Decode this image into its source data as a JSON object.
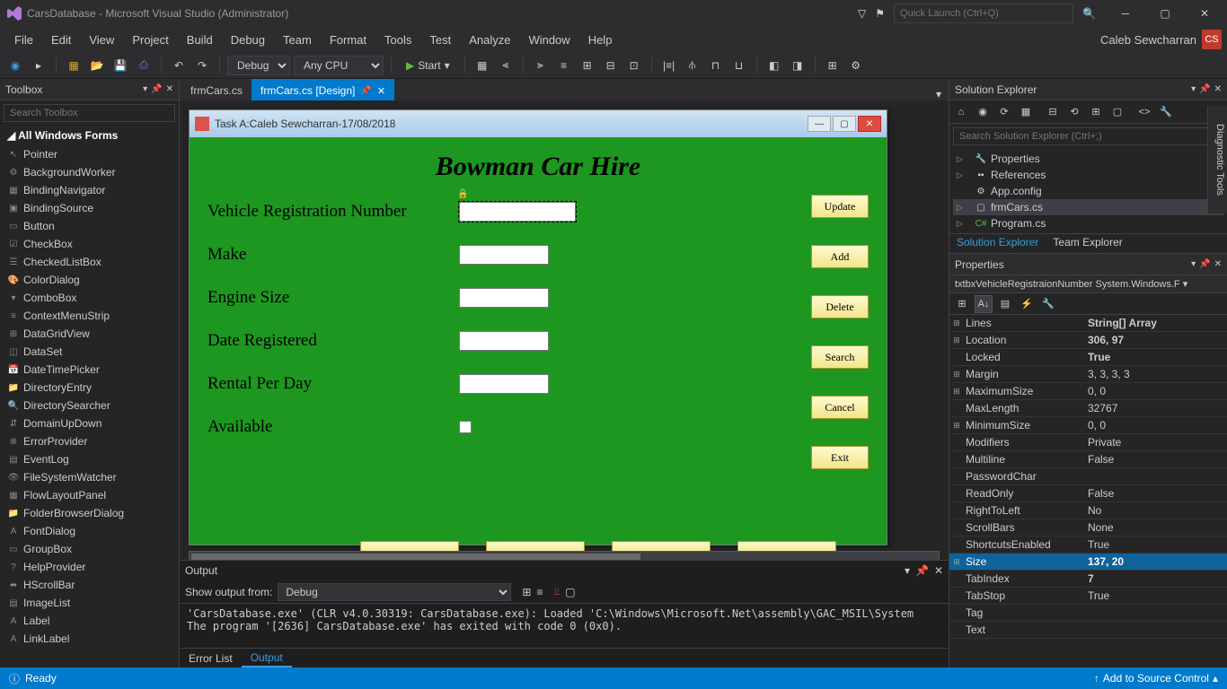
{
  "titlebar": {
    "title": "CarsDatabase - Microsoft Visual Studio  (Administrator)",
    "quick_launch_placeholder": "Quick Launch (Ctrl+Q)"
  },
  "menubar": {
    "items": [
      "File",
      "Edit",
      "View",
      "Project",
      "Build",
      "Debug",
      "Team",
      "Format",
      "Tools",
      "Test",
      "Analyze",
      "Window",
      "Help"
    ],
    "user": "Caleb Sewcharran",
    "user_initials": "CS"
  },
  "toolbar": {
    "config": "Debug",
    "platform": "Any CPU",
    "start": "Start"
  },
  "toolbox": {
    "title": "Toolbox",
    "search_placeholder": "Search Toolbox",
    "group": "All Windows Forms",
    "items": [
      "Pointer",
      "BackgroundWorker",
      "BindingNavigator",
      "BindingSource",
      "Button",
      "CheckBox",
      "CheckedListBox",
      "ColorDialog",
      "ComboBox",
      "ContextMenuStrip",
      "DataGridView",
      "DataSet",
      "DateTimePicker",
      "DirectoryEntry",
      "DirectorySearcher",
      "DomainUpDown",
      "ErrorProvider",
      "EventLog",
      "FileSystemWatcher",
      "FlowLayoutPanel",
      "FolderBrowserDialog",
      "FontDialog",
      "GroupBox",
      "HelpProvider",
      "HScrollBar",
      "ImageList",
      "Label",
      "LinkLabel"
    ]
  },
  "doc_tabs": {
    "tabs": [
      {
        "label": "frmCars.cs",
        "active": false
      },
      {
        "label": "frmCars.cs [Design]",
        "active": true
      }
    ]
  },
  "form": {
    "title": "Task A:Caleb Sewcharran-17/08/2018",
    "heading": "Bowman Car Hire",
    "labels": {
      "reg": "Vehicle Registration Number",
      "make": "Make",
      "engine": "Engine Size",
      "date": "Date Registered",
      "rental": "Rental Per Day",
      "available": "Available"
    },
    "buttons": {
      "update": "Update",
      "add": "Add",
      "delete": "Delete",
      "search": "Search",
      "cancel": "Cancel",
      "exit": "Exit"
    }
  },
  "output": {
    "title": "Output",
    "show_from_label": "Show output from:",
    "show_from_value": "Debug",
    "lines": "'CarsDatabase.exe' (CLR v4.0.30319: CarsDatabase.exe): Loaded 'C:\\Windows\\Microsoft.Net\\assembly\\GAC_MSIL\\System\nThe program '[2636] CarsDatabase.exe' has exited with code 0 (0x0).",
    "tabs": {
      "error_list": "Error List",
      "output": "Output"
    }
  },
  "solution": {
    "title": "Solution Explorer",
    "search_placeholder": "Search Solution Explorer (Ctrl+;)",
    "nodes": {
      "properties": "Properties",
      "references": "References",
      "appconfig": "App.config",
      "frmcars": "frmCars.cs",
      "program": "Program.cs"
    },
    "tabs": {
      "sol": "Solution Explorer",
      "team": "Team Explorer"
    }
  },
  "properties": {
    "title": "Properties",
    "object": "txtbxVehicleRegistraionNumber System.Windows.F",
    "rows": [
      {
        "exp": "⊞",
        "name": "Lines",
        "val": "String[] Array",
        "bold": true
      },
      {
        "exp": "⊞",
        "name": "Location",
        "val": "306, 97",
        "bold": true
      },
      {
        "exp": "",
        "name": "Locked",
        "val": "True",
        "bold": true
      },
      {
        "exp": "⊞",
        "name": "Margin",
        "val": "3, 3, 3, 3",
        "bold": false
      },
      {
        "exp": "⊞",
        "name": "MaximumSize",
        "val": "0, 0",
        "bold": false
      },
      {
        "exp": "",
        "name": "MaxLength",
        "val": "32767",
        "bold": false
      },
      {
        "exp": "⊞",
        "name": "MinimumSize",
        "val": "0, 0",
        "bold": false
      },
      {
        "exp": "",
        "name": "Modifiers",
        "val": "Private",
        "bold": false
      },
      {
        "exp": "",
        "name": "Multiline",
        "val": "False",
        "bold": false
      },
      {
        "exp": "",
        "name": "PasswordChar",
        "val": "",
        "bold": false
      },
      {
        "exp": "",
        "name": "ReadOnly",
        "val": "False",
        "bold": false
      },
      {
        "exp": "",
        "name": "RightToLeft",
        "val": "No",
        "bold": false
      },
      {
        "exp": "",
        "name": "ScrollBars",
        "val": "None",
        "bold": false
      },
      {
        "exp": "",
        "name": "ShortcutsEnabled",
        "val": "True",
        "bold": false
      },
      {
        "exp": "⊞",
        "name": "Size",
        "val": "137, 20",
        "bold": true,
        "selected": true
      },
      {
        "exp": "",
        "name": "TabIndex",
        "val": "7",
        "bold": true
      },
      {
        "exp": "",
        "name": "TabStop",
        "val": "True",
        "bold": false
      },
      {
        "exp": "",
        "name": "Tag",
        "val": "",
        "bold": false
      },
      {
        "exp": "",
        "name": "Text",
        "val": "",
        "bold": false
      }
    ]
  },
  "diagnostic": "Diagnostic Tools",
  "statusbar": {
    "ready": "Ready",
    "src_ctrl": "Add to Source Control"
  }
}
